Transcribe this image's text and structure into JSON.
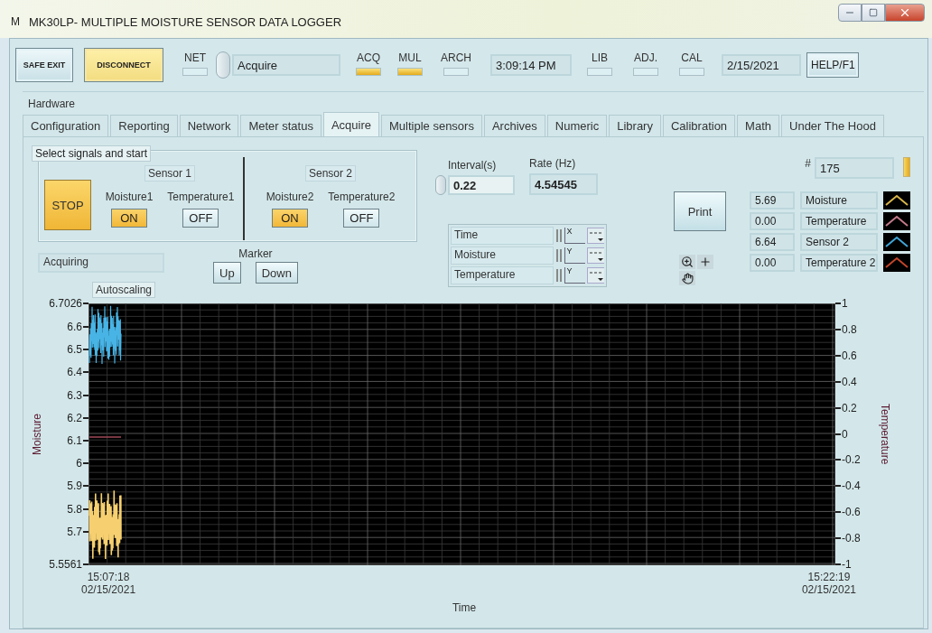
{
  "window": {
    "icon_letter": "M",
    "title": "MK30LP- MULTIPLE MOISTURE SENSOR DATA LOGGER"
  },
  "toolbar": [
    {
      "kind": "button",
      "label": "SAFE EXIT",
      "active": false
    },
    {
      "kind": "button",
      "label": "DISCONNECT",
      "active": true
    },
    {
      "kind": "led",
      "label": "NET",
      "on": false
    },
    {
      "kind": "selector",
      "value": "Acquire"
    },
    {
      "kind": "led",
      "label": "ACQ",
      "on": true
    },
    {
      "kind": "led",
      "label": "MUL",
      "on": true
    },
    {
      "kind": "led",
      "label": "ARCH",
      "on": false
    },
    {
      "kind": "display",
      "value": "3:09:14 PM"
    },
    {
      "kind": "led",
      "label": "LIB",
      "on": false
    },
    {
      "kind": "led",
      "label": "ADJ.",
      "on": false
    },
    {
      "kind": "led",
      "label": "CAL",
      "on": false
    },
    {
      "kind": "display",
      "value": "2/15/2021"
    },
    {
      "kind": "button",
      "label": "HELP/F1",
      "active": false
    }
  ],
  "tab_group": "Hardware",
  "tabs": [
    {
      "label": "Configuration",
      "selected": false
    },
    {
      "label": "Reporting",
      "selected": false
    },
    {
      "label": "Network",
      "selected": false
    },
    {
      "label": "Meter status",
      "selected": false
    },
    {
      "label": "Acquire",
      "selected": true
    },
    {
      "label": "Multiple sensors",
      "selected": false
    },
    {
      "label": "Archives",
      "selected": false
    },
    {
      "label": "Numeric",
      "selected": false
    },
    {
      "label": "Library",
      "selected": false
    },
    {
      "label": "Calibration",
      "selected": false
    },
    {
      "label": "Math",
      "selected": false
    },
    {
      "label": "Under The Hood",
      "selected": false
    }
  ],
  "signals": {
    "title": "Select signals and start",
    "start_button": {
      "label": "STOP",
      "active": true
    },
    "sensors": [
      {
        "name": "Sensor 1",
        "channels": [
          {
            "label": "Moisture1",
            "on": true,
            "state_text": "ON"
          },
          {
            "label": "Temperature1",
            "on": false,
            "state_text": "OFF"
          }
        ]
      },
      {
        "name": "Sensor 2",
        "channels": [
          {
            "label": "Moisture2",
            "on": true,
            "state_text": "ON"
          },
          {
            "label": "Temperature2",
            "on": false,
            "state_text": "OFF"
          }
        ]
      }
    ]
  },
  "status": "Acquiring",
  "marker": {
    "label": "Marker",
    "buttons": [
      "Up",
      "Down"
    ]
  },
  "autoscaling": "Autoscaling",
  "interval": {
    "label": "Interval(s)",
    "value": "0.22"
  },
  "rate": {
    "label": "Rate (Hz)",
    "value": "4.54545"
  },
  "axis_formats": [
    {
      "name": "Time",
      "axis": "X"
    },
    {
      "name": "Moisture",
      "axis": "Y"
    },
    {
      "name": "Temperature",
      "axis": "Y"
    }
  ],
  "print_button": "Print",
  "count": {
    "label": "#",
    "value": "175"
  },
  "legend": [
    {
      "value": "5.69",
      "name": "Moisture",
      "color": "#d9b64a"
    },
    {
      "value": "0.00",
      "name": "Temperature",
      "color": "#c27a8a"
    },
    {
      "value": "6.64",
      "name": "Sensor 2",
      "color": "#3fa6d6"
    },
    {
      "value": "0.00",
      "name": "Temperature 2",
      "color": "#c2452a"
    }
  ],
  "graph": {
    "y_label": "Moisture",
    "y_ticks": [
      "6.7026",
      "6.6",
      "6.5",
      "6.4",
      "6.3",
      "6.2",
      "6.1",
      "6",
      "5.9",
      "5.8",
      "5.7",
      "5.5561"
    ],
    "y2_label": "Temperature",
    "y2_ticks": [
      "1",
      "0.8",
      "0.6",
      "0.4",
      "0.2",
      "0",
      "-0.2",
      "-0.4",
      "-0.6",
      "-0.8",
      "-1"
    ],
    "x_start": [
      "15:07:18",
      "02/15/2021"
    ],
    "x_end": [
      "15:22:19",
      "02/15/2021"
    ],
    "x_label": "Time"
  }
}
